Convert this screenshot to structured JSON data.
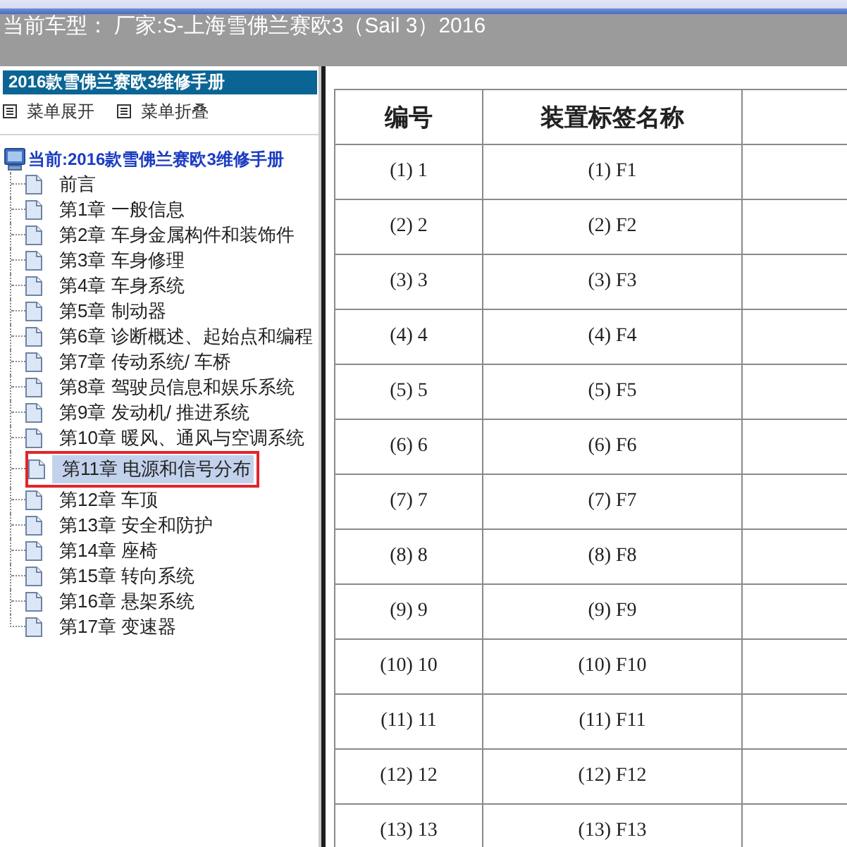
{
  "window": {
    "title": "当前车型：  厂家:S-上海雪佛兰赛欧3（Sail 3）2016"
  },
  "sidebar": {
    "title": "2016款雪佛兰赛欧3维修手册",
    "menu": [
      {
        "label": "菜单展开"
      },
      {
        "label": "菜单折叠"
      }
    ],
    "tree": {
      "label": "当前:2016款雪佛兰赛欧3维修手册",
      "children": [
        {
          "label": "前言",
          "selected": false,
          "outlined": false
        },
        {
          "label": "第1章 一般信息",
          "selected": false,
          "outlined": false
        },
        {
          "label": "第2章 车身金属构件和装饰件",
          "selected": false,
          "outlined": false
        },
        {
          "label": "第3章 车身修理",
          "selected": false,
          "outlined": false
        },
        {
          "label": "第4章 车身系统",
          "selected": false,
          "outlined": false
        },
        {
          "label": "第5章 制动器",
          "selected": false,
          "outlined": false
        },
        {
          "label": "第6章 诊断概述、起始点和编程",
          "selected": false,
          "outlined": false
        },
        {
          "label": "第7章 传动系统/ 车桥",
          "selected": false,
          "outlined": false
        },
        {
          "label": "第8章 驾驶员信息和娱乐系统",
          "selected": false,
          "outlined": false
        },
        {
          "label": "第9章 发动机/ 推进系统",
          "selected": false,
          "outlined": false
        },
        {
          "label": "第10章 暖风、通风与空调系统",
          "selected": false,
          "outlined": false
        },
        {
          "label": "第11章 电源和信号分布",
          "selected": true,
          "outlined": true
        },
        {
          "label": "第12章 车顶",
          "selected": false,
          "outlined": false
        },
        {
          "label": "第13章 安全和防护",
          "selected": false,
          "outlined": false
        },
        {
          "label": "第14章 座椅",
          "selected": false,
          "outlined": false
        },
        {
          "label": "第15章 转向系统",
          "selected": false,
          "outlined": false
        },
        {
          "label": "第16章 悬架系统",
          "selected": false,
          "outlined": false
        },
        {
          "label": "第17章 变速器",
          "selected": false,
          "outlined": false
        }
      ]
    }
  },
  "table": {
    "columns": [
      "编号",
      "装置标签名称"
    ],
    "rows": [
      [
        "(1) 1",
        "(1) F1"
      ],
      [
        "(2) 2",
        "(2) F2"
      ],
      [
        "(3) 3",
        "(3) F3"
      ],
      [
        "(4) 4",
        "(4) F4"
      ],
      [
        "(5) 5",
        "(5) F5"
      ],
      [
        "(6) 6",
        "(6) F6"
      ],
      [
        "(7) 7",
        "(7) F7"
      ],
      [
        "(8) 8",
        "(8) F8"
      ],
      [
        "(9) 9",
        "(9) F9"
      ],
      [
        "(10) 10",
        "(10) F10"
      ],
      [
        "(11) 11",
        "(11) F11"
      ],
      [
        "(12) 12",
        "(12) F12"
      ],
      [
        "(13) 13",
        "(13) F13"
      ]
    ]
  }
}
